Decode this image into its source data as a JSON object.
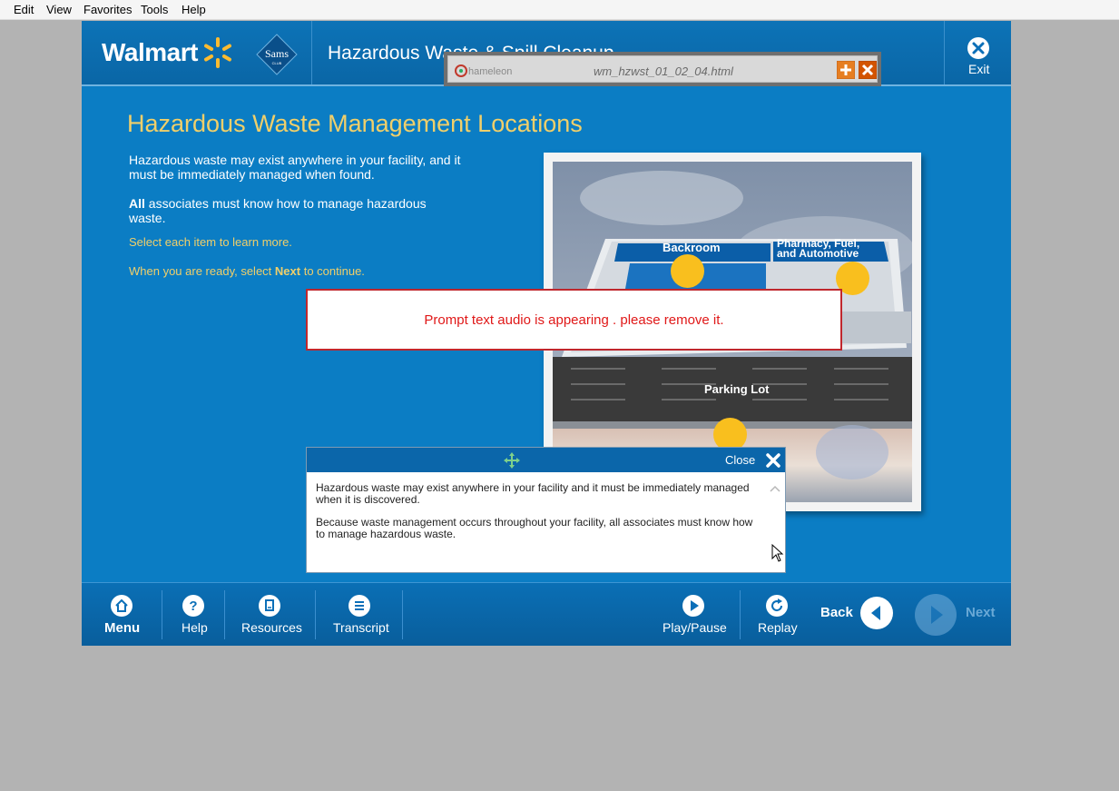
{
  "menubar": {
    "items": [
      "Edit",
      "View",
      "Favorites",
      "Tools",
      "Help"
    ]
  },
  "header": {
    "brand_name": "Walmart",
    "sams_club_text": "Sams",
    "sams_club_sub": "CLUB",
    "course_title": "Hazardous Waste & Spill Cleanup",
    "exit_label": "Exit"
  },
  "chameleon_bar": {
    "logo_text": "hameleon",
    "file_name": "wm_hzwst_01_02_04.html"
  },
  "content": {
    "title": "Hazardous Waste Management Locations",
    "para1": "Hazardous waste may exist anywhere in your facility, and it must be immediately managed when found.",
    "para2_bold": "All",
    "para2_rest": " associates must know how to manage hazardous waste.",
    "instruction1": "Select each item to learn more.",
    "instruction2_a": "When you are ready, select ",
    "instruction2_b": "Next",
    "instruction2_c": " to continue."
  },
  "store_map": {
    "labels": {
      "backroom": "Backroom",
      "pharmacy_line1": "Pharmacy, Fuel,",
      "pharmacy_line2": "and Automotive",
      "parking": "Parking Lot"
    },
    "hotspot_color": "#f9bf1e"
  },
  "prompt_overlay": {
    "text": "Prompt text audio is appearing . please remove it."
  },
  "transcript_panel": {
    "close_label": "Close",
    "paragraphs": [
      "Hazardous waste may exist anywhere in your facility and it must be immediately managed when it is discovered.",
      "Because waste management occurs throughout your facility, all associates must know how to manage hazardous waste."
    ]
  },
  "footer": {
    "menu_label": "Menu",
    "help_label": "Help",
    "resources_label": "Resources",
    "transcript_label": "Transcript",
    "playpause_label": "Play/Pause",
    "replay_label": "Replay",
    "back_label": "Back",
    "next_label": "Next"
  },
  "colors": {
    "app_blue": "#0b7dc4",
    "title_gold": "#f0cf6a",
    "prompt_red": "#e01818"
  }
}
